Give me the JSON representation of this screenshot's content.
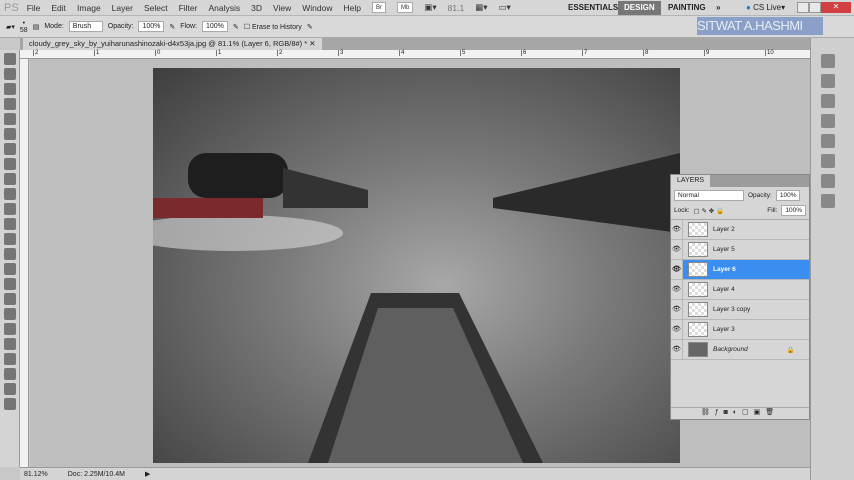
{
  "app": {
    "logo": "PS",
    "menu": [
      "File",
      "Edit",
      "Image",
      "Layer",
      "Select",
      "Filter",
      "Analysis",
      "3D",
      "View",
      "Window",
      "Help"
    ],
    "bridge": "Br",
    "minibridge": "Mb",
    "zoom_value": "81.1",
    "workspaces": [
      "ESSENTIALS",
      "DESIGN",
      "PAINTING"
    ],
    "more": "»",
    "cs_live": "CS Live"
  },
  "options": {
    "brush_size": "58",
    "mode_label": "Mode:",
    "mode_value": "Brush",
    "opacity_label": "Opacity:",
    "opacity_value": "100%",
    "flow_label": "Flow:",
    "flow_value": "100%",
    "erase_history": "Erase to History"
  },
  "watermark": "SITWAT A.HASHMI",
  "document": {
    "tab_title": "cloudy_grey_sky_by_yuiharunashinozaki-d4x53ja.jpg @ 81.1% (Layer 6, RGB/8#) *",
    "ruler_ticks": [
      "2",
      "1",
      "0",
      "1",
      "2",
      "3",
      "4",
      "5",
      "6",
      "7",
      "8",
      "9",
      "10"
    ]
  },
  "status": {
    "zoom": "81.12%",
    "doc": "Doc: 2.25M/10.4M"
  },
  "layers": {
    "title": "LAYERS",
    "blend_mode": "Normal",
    "opacity_label": "Opacity:",
    "opacity_value": "100%",
    "lock_label": "Lock:",
    "fill_label": "Fill:",
    "fill_value": "100%",
    "items": [
      {
        "name": "Layer 2"
      },
      {
        "name": "Layer 5"
      },
      {
        "name": "Layer 6",
        "selected": true
      },
      {
        "name": "Layer 4"
      },
      {
        "name": "Layer 3 copy"
      },
      {
        "name": "Layer 3"
      },
      {
        "name": "Background",
        "locked": true
      }
    ]
  }
}
